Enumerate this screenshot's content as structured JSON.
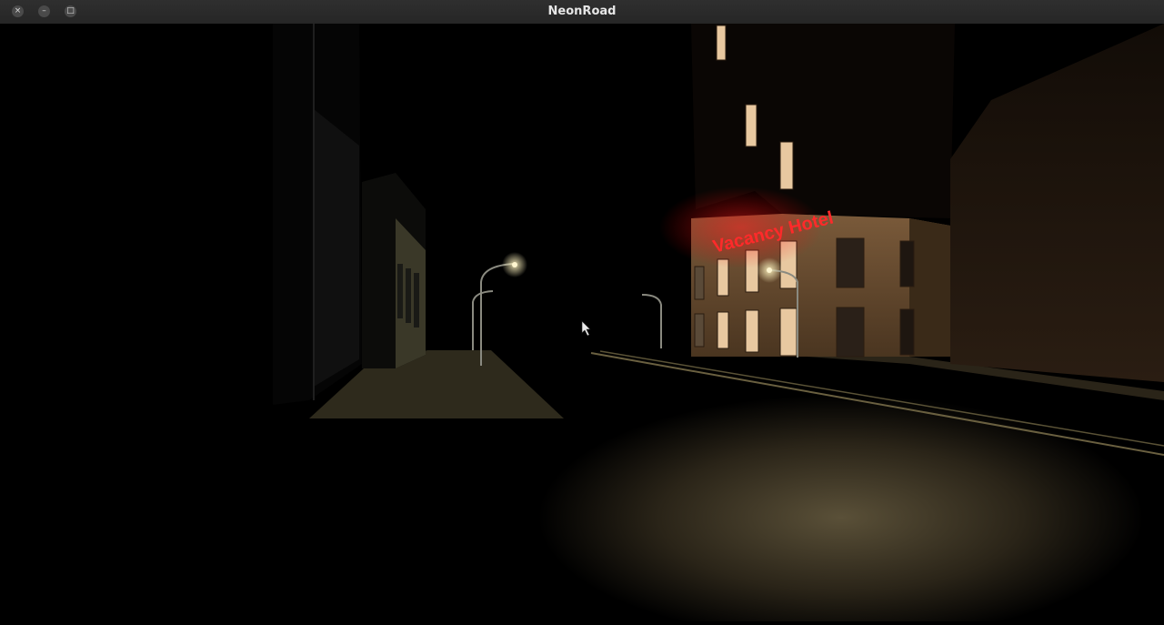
{
  "window": {
    "title": "NeonRoad",
    "close_glyph": "×",
    "minimize_glyph": "–",
    "maximize_glyph": "□"
  },
  "scene": {
    "neon_sign_text": "Vacancy Hotel",
    "neon_color": "#ff1a1a",
    "streetlight_color": "#ffe9a8",
    "window_light_color": "#e8c8a0"
  },
  "icons": {
    "cursor": "mouse-pointer-icon"
  }
}
